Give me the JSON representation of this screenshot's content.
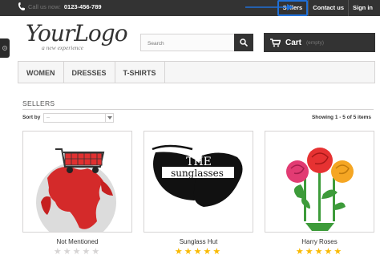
{
  "topbar": {
    "call_label": "Call us now:",
    "phone": "0123-456-789",
    "nav": [
      "Sellers",
      "Contact us",
      "Sign in"
    ]
  },
  "logo": {
    "word": "YourLogo",
    "tagline": "a new experience"
  },
  "search": {
    "placeholder": "Search"
  },
  "cart": {
    "label": "Cart",
    "status": "(empty)"
  },
  "menu": [
    "WOMEN",
    "DRESSES",
    "T-SHIRTS"
  ],
  "listing": {
    "title": "SELLERS",
    "sort_label": "Sort by",
    "sort_value": "--",
    "showing": "Showing 1 - 5 of 5 items"
  },
  "sellers": [
    {
      "name": "Not Mentioned",
      "rating": 0
    },
    {
      "name": "Sunglass Hut",
      "rating": 5
    },
    {
      "name": "Harry Roses",
      "rating": 5
    }
  ],
  "colors": {
    "accent": "#1f6fd6",
    "star": "#f9b900",
    "dark": "#333333"
  }
}
